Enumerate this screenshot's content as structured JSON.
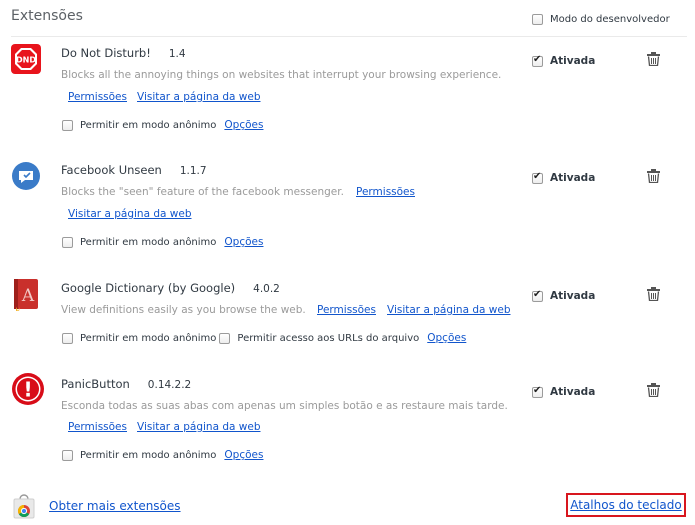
{
  "page": {
    "title": "Extensões",
    "developer_mode_label": "Modo do desenvolvedor"
  },
  "common": {
    "enabled_label": "Ativada",
    "incognito_label": "Permitir em modo anônimo",
    "file_urls_label": "Permitir acesso aos URLs do arquivo",
    "options_link": "Opções",
    "permissions_link": "Permissões",
    "website_link": "Visitar a página da web"
  },
  "extensions": [
    {
      "name": "Do Not Disturb!",
      "version": "1.4",
      "description": "Blocks all the annoying things on websites that interrupt your browsing experience.",
      "icon": "dnd-icon",
      "icon_text": "DND",
      "enabled": true
    },
    {
      "name": "Facebook Unseen",
      "version": "1.1.7",
      "description": "Blocks the \"seen\" feature of the facebook messenger.",
      "icon": "facebook-unseen-icon",
      "enabled": true
    },
    {
      "name": "Google Dictionary (by Google)",
      "version": "4.0.2",
      "description": "View definitions easily as you browse the web.",
      "icon": "dictionary-icon",
      "icon_text": "A",
      "enabled": true
    },
    {
      "name": "PanicButton",
      "version": "0.14.2.2",
      "description": "Esconda todas as suas abas com apenas um simples botão e as restaure mais tarde.",
      "icon": "panic-button-icon",
      "icon_text": "!",
      "enabled": true
    }
  ],
  "footer": {
    "more_extensions_link": "Obter mais extensões",
    "keyboard_shortcuts_link": "Atalhos do teclado"
  },
  "colors": {
    "link": "#1155cc",
    "dnd_red": "#e8141c",
    "dictionary_red": "#c9302c",
    "panic_red": "#d80c18",
    "messenger_blue": "#3a7bc8",
    "highlight_border": "#d8161e"
  }
}
